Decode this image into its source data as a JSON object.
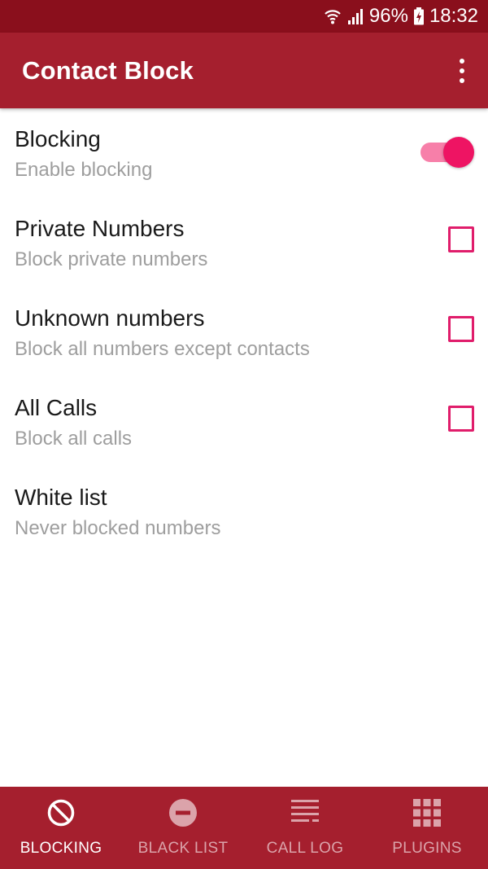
{
  "status_bar": {
    "battery": "96%",
    "time": "18:32",
    "icons": [
      "wifi-icon",
      "signal-icon",
      "battery-charging-icon"
    ]
  },
  "app_bar": {
    "title": "Contact Block",
    "menu_icon": "more-vert-icon"
  },
  "preferences": [
    {
      "title": "Blocking",
      "summary": "Enable blocking",
      "control": "switch",
      "checked": true
    },
    {
      "title": "Private Numbers",
      "summary": "Block private numbers",
      "control": "checkbox",
      "checked": false
    },
    {
      "title": "Unknown numbers",
      "summary": "Block all numbers except contacts",
      "control": "checkbox",
      "checked": false
    },
    {
      "title": "All Calls",
      "summary": "Block all calls",
      "control": "checkbox",
      "checked": false
    },
    {
      "title": "White list",
      "summary": "Never blocked numbers",
      "control": "none"
    }
  ],
  "bottom_nav": {
    "items": [
      {
        "label": "BLOCKING",
        "icon": "block-icon",
        "active": true
      },
      {
        "label": "BLACK LIST",
        "icon": "minus-circle-icon",
        "active": false
      },
      {
        "label": "CALL LOG",
        "icon": "list-icon",
        "active": false
      },
      {
        "label": "PLUGINS",
        "icon": "grid-icon",
        "active": false
      }
    ]
  },
  "colors": {
    "status_bar": "#8a0f1c",
    "primary": "#a51f2e",
    "accent": "#ee1463",
    "switch_track": "#f77fa9",
    "nav_inactive": "#dba3aa",
    "summary_text": "#9e9e9e"
  }
}
